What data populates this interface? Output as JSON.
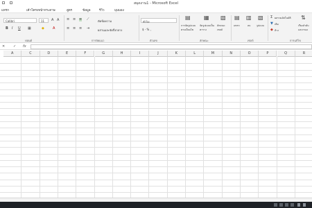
{
  "window": {
    "title": "สมุดงาน1 - Microsoft Excel"
  },
  "menu": [
    {
      "id": "file",
      "label": "แทรก"
    },
    {
      "id": "layout",
      "label": "เค้าโครงหน้ากระดาษ"
    },
    {
      "id": "formulas",
      "label": "สูตร"
    },
    {
      "id": "data",
      "label": "ข้อมูล"
    },
    {
      "id": "review",
      "label": "รีวิว"
    },
    {
      "id": "view",
      "label": "มุมมอง"
    }
  ],
  "ribbon": {
    "font_name": "Calibri",
    "font_size": "11",
    "wrap_text": "ตัดข้อความ",
    "merge_center": "ผสานและจัดกึ่งกลาง",
    "number_format": "ทั่วไป",
    "currency": "$ - % ,",
    "cond_format": "การจัดรูปแบบตามเงื่อนไข",
    "format_table": "จัดรูปแบบเป็นตาราง",
    "cell_styles": "ลักษณะเซลล์",
    "insert": "แทรก",
    "delete": "ลบ",
    "format": "รูปแบบ",
    "autosum": "ผลรวมอัตโนมัติ",
    "fill": "เติม",
    "clear": "ล้าง",
    "sort_filter": "เรียงลำดับและกรอง",
    "groups": {
      "font": "ฟอนต์",
      "alignment": "การจัดแนว",
      "number": "ตัวเลข",
      "styles": "ลักษณะ",
      "cells": "เซลล์",
      "editing": "การแก้ไข"
    }
  },
  "formula_bar": {
    "fx": "fx",
    "cancel": "✕",
    "enter": "✓"
  },
  "columns": [
    "A",
    "C",
    "D",
    "E",
    "F",
    "G",
    "H",
    "I",
    "J",
    "K",
    "L",
    "M",
    "N",
    "O",
    "P",
    "Q",
    "R",
    "S"
  ]
}
